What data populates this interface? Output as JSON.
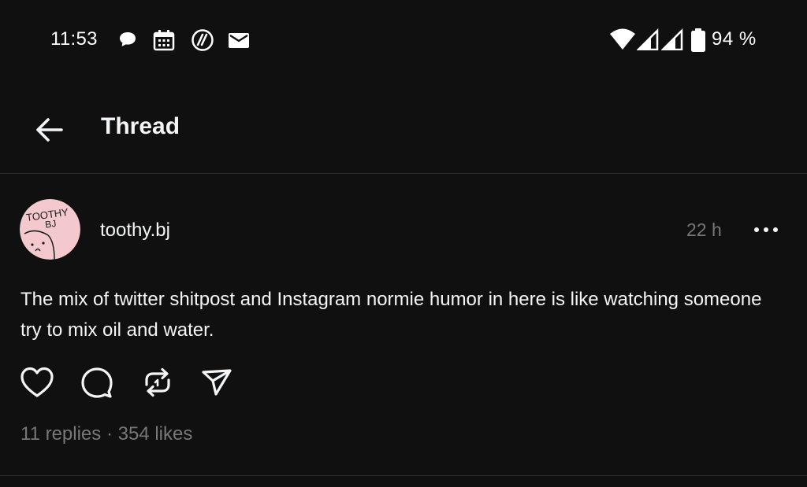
{
  "status_bar": {
    "time": "11:53",
    "battery_text": "94 %",
    "icons": [
      "chat-notification-icon",
      "calendar-icon",
      "threads-notification-icon",
      "mail-icon",
      "wifi-icon",
      "signal-icon",
      "signal-icon",
      "battery-icon"
    ]
  },
  "app_bar": {
    "back_icon": "arrow-left-icon",
    "title": "Thread"
  },
  "post": {
    "avatar_text": {
      "line1": "TOOTHY",
      "line2": "BJ"
    },
    "username": "toothy.bj",
    "time": "22 h",
    "more_icon": "more-horizontal-icon",
    "text": "The mix of twitter shitpost and Instagram normie humor in here is like watching someone try to mix oil and water.",
    "actions": [
      "heart-icon",
      "comment-icon",
      "repost-icon",
      "share-icon"
    ],
    "stats": "11 replies · 354 likes"
  },
  "colors": {
    "background": "#101010",
    "text_primary": "#f3f5f7",
    "text_secondary": "#777777",
    "divider": "#2a2a2a",
    "avatar_bg": "#f4c9cd"
  }
}
